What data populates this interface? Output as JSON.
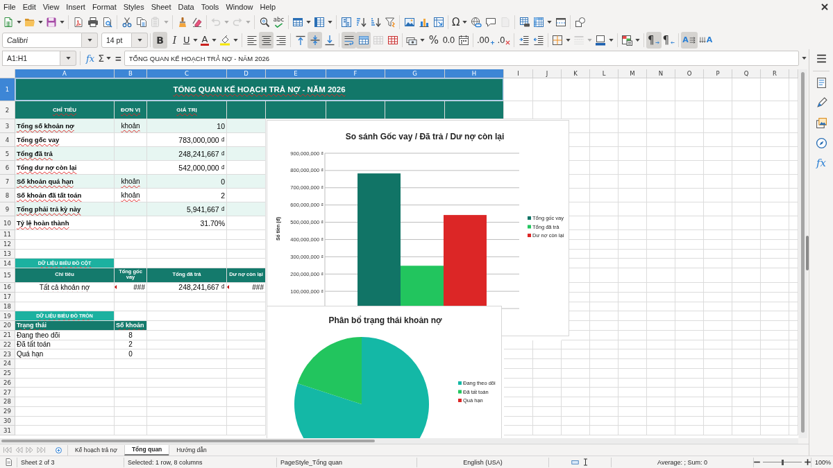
{
  "menu_bar": {
    "items": [
      "File",
      "Edit",
      "View",
      "Insert",
      "Format",
      "Styles",
      "Sheet",
      "Data",
      "Tools",
      "Window",
      "Help"
    ]
  },
  "standard_toolbar": {
    "groups": [
      [
        {
          "kind": "new",
          "disabled": false,
          "dropdown": true
        },
        {
          "kind": "open",
          "disabled": false,
          "dropdown": true
        },
        {
          "kind": "save",
          "disabled": false,
          "dropdown": true
        }
      ],
      [
        {
          "kind": "export_pdf",
          "disabled": false,
          "dropdown": false
        },
        {
          "kind": "print",
          "disabled": false,
          "dropdown": false
        },
        {
          "kind": "print_preview",
          "disabled": false,
          "dropdown": false
        }
      ],
      [
        {
          "kind": "cut",
          "disabled": false,
          "dropdown": false
        },
        {
          "kind": "copy",
          "disabled": false,
          "dropdown": false
        },
        {
          "kind": "paste",
          "disabled": true,
          "dropdown": true
        }
      ],
      [
        {
          "kind": "clone_format",
          "disabled": false,
          "dropdown": false
        },
        {
          "kind": "clear_format",
          "disabled": false,
          "dropdown": false
        }
      ],
      [
        {
          "kind": "undo",
          "disabled": true,
          "dropdown": true
        },
        {
          "kind": "redo",
          "disabled": true,
          "dropdown": true
        }
      ],
      [
        {
          "kind": "find_replace",
          "disabled": false,
          "dropdown": false
        },
        {
          "kind": "spelling",
          "label": "abc",
          "disabled": false,
          "dropdown": false
        }
      ],
      [
        {
          "kind": "row",
          "disabled": false,
          "dropdown": true
        },
        {
          "kind": "column",
          "disabled": false,
          "dropdown": true
        }
      ],
      [
        {
          "kind": "sort",
          "disabled": false,
          "dropdown": false
        },
        {
          "kind": "sort_ascending",
          "disabled": false,
          "dropdown": false
        },
        {
          "kind": "sort_descending",
          "disabled": false,
          "dropdown": false
        },
        {
          "kind": "autofilter",
          "disabled": false,
          "dropdown": false
        }
      ],
      [
        {
          "kind": "image",
          "disabled": false,
          "dropdown": false
        },
        {
          "kind": "chart",
          "disabled": false,
          "dropdown": false
        },
        {
          "kind": "pivot_table",
          "disabled": false,
          "dropdown": false
        }
      ],
      [
        {
          "kind": "special_character",
          "label": "Ω",
          "disabled": false,
          "dropdown": true
        },
        {
          "kind": "hyperlink",
          "disabled": false,
          "dropdown": false
        },
        {
          "kind": "comment",
          "disabled": false,
          "dropdown": false
        },
        {
          "kind": "header_footer",
          "disabled": true,
          "dropdown": false
        }
      ],
      [
        {
          "kind": "print_area",
          "disabled": false,
          "dropdown": false
        },
        {
          "kind": "freeze",
          "disabled": false,
          "dropdown": true
        },
        {
          "kind": "split_window",
          "disabled": false,
          "dropdown": false
        }
      ],
      [
        {
          "kind": "shapes",
          "disabled": false,
          "dropdown": false
        }
      ]
    ]
  },
  "format_toolbar": {
    "font_name": "Calibri",
    "font_size": "14 pt",
    "groups": [
      [
        {
          "kind": "bold",
          "label": "B",
          "pressed": true,
          "disabled": false,
          "dropdown": false
        },
        {
          "kind": "italic",
          "label": "I",
          "pressed": false,
          "disabled": false,
          "dropdown": false
        },
        {
          "kind": "underline",
          "label": "U",
          "pressed": false,
          "disabled": false,
          "dropdown": true
        },
        {
          "kind": "font_color",
          "label": "A",
          "pressed": false,
          "disabled": false,
          "dropdown": true
        },
        {
          "kind": "highlight",
          "pressed": false,
          "disabled": false,
          "dropdown": true
        }
      ],
      [
        {
          "kind": "align_left",
          "pressed": false,
          "disabled": false,
          "dropdown": false
        },
        {
          "kind": "align_center",
          "pressed": true,
          "disabled": false,
          "dropdown": false
        },
        {
          "kind": "align_right",
          "pressed": false,
          "disabled": false,
          "dropdown": false
        }
      ],
      [
        {
          "kind": "align_top",
          "pressed": false,
          "disabled": false,
          "dropdown": false
        },
        {
          "kind": "align_middle",
          "pressed": true,
          "disabled": false,
          "dropdown": false
        },
        {
          "kind": "align_bottom",
          "pressed": false,
          "disabled": false,
          "dropdown": false
        }
      ],
      [
        {
          "kind": "wrap",
          "pressed": true,
          "disabled": false,
          "dropdown": false
        },
        {
          "kind": "merge_center",
          "pressed": true,
          "disabled": false,
          "dropdown": false
        },
        {
          "kind": "merge",
          "pressed": false,
          "disabled": true,
          "dropdown": false
        },
        {
          "kind": "unmerge",
          "pressed": false,
          "disabled": false,
          "dropdown": false
        }
      ],
      [
        {
          "kind": "currency",
          "pressed": false,
          "disabled": false,
          "dropdown": true
        },
        {
          "kind": "percent",
          "label": "%",
          "pressed": false,
          "disabled": false,
          "dropdown": false
        },
        {
          "kind": "number",
          "label": "0.0",
          "pressed": false,
          "disabled": false,
          "dropdown": false
        },
        {
          "kind": "date",
          "pressed": false,
          "disabled": false,
          "dropdown": false
        }
      ],
      [
        {
          "kind": "add_decimal",
          "label": ".00",
          "pressed": false,
          "disabled": false,
          "dropdown": false
        },
        {
          "kind": "delete_decimal",
          "label": ".0",
          "pressed": false,
          "disabled": false,
          "dropdown": false
        }
      ],
      [
        {
          "kind": "indent",
          "pressed": false,
          "disabled": false,
          "dropdown": false
        },
        {
          "kind": "outdent",
          "pressed": false,
          "disabled": false,
          "dropdown": false
        }
      ],
      [
        {
          "kind": "borders",
          "pressed": false,
          "disabled": false,
          "dropdown": true
        },
        {
          "kind": "border_style",
          "pressed": false,
          "disabled": true,
          "dropdown": true
        },
        {
          "kind": "border_color",
          "pressed": false,
          "disabled": false,
          "dropdown": true
        }
      ],
      [
        {
          "kind": "conditional",
          "pressed": false,
          "disabled": false,
          "dropdown": true
        }
      ],
      [
        {
          "kind": "ltr",
          "label": "¶",
          "pressed": true,
          "disabled": false,
          "dropdown": false
        },
        {
          "kind": "rtl",
          "label": "¶",
          "pressed": false,
          "disabled": false,
          "dropdown": false
        }
      ],
      [
        {
          "kind": "text_direction",
          "label": "A",
          "pressed": true,
          "disabled": false,
          "dropdown": false
        },
        {
          "kind": "stacked",
          "label": "A",
          "pressed": false,
          "disabled": false,
          "dropdown": false
        }
      ]
    ]
  },
  "formula_bar": {
    "name_box": "A1:H1",
    "function_wizard": "fx",
    "sum": "Σ",
    "equals": "=",
    "content": "TỔNG QUAN KẾ HOẠCH TRẢ NỢ - NĂM 2026"
  },
  "sheet": {
    "columns": [
      {
        "label": "A",
        "selected": true
      },
      {
        "label": "B",
        "selected": true
      },
      {
        "label": "C",
        "selected": true
      },
      {
        "label": "D",
        "selected": true
      },
      {
        "label": "E",
        "selected": true
      },
      {
        "label": "F",
        "selected": true
      },
      {
        "label": "G",
        "selected": true
      },
      {
        "label": "H",
        "selected": true
      },
      {
        "label": "I",
        "selected": false
      },
      {
        "label": "J",
        "selected": false
      },
      {
        "label": "K",
        "selected": false
      },
      {
        "label": "L",
        "selected": false
      },
      {
        "label": "M",
        "selected": false
      },
      {
        "label": "N",
        "selected": false
      },
      {
        "label": "O",
        "selected": false
      },
      {
        "label": "P",
        "selected": false
      },
      {
        "label": "Q",
        "selected": false
      },
      {
        "label": "R",
        "selected": false
      }
    ],
    "rows": [
      {
        "label": "1",
        "selected": true,
        "kind": "plain",
        "cells": [
          {
            "kind": "title",
            "text": "TỔNG QUAN KẾ HOẠCH TRẢ NỢ - NĂM 2026"
          }
        ]
      },
      {
        "label": "2",
        "selected": false,
        "kind": "header",
        "cells": [
          {
            "kind": "header",
            "text": "CHỈ TIÊU"
          },
          {
            "kind": "header",
            "text": "ĐƠN VỊ"
          },
          {
            "kind": "header",
            "text": "GIÁ TRỊ"
          }
        ]
      },
      {
        "label": "3",
        "selected": false,
        "kind": "banded",
        "cells": [
          {
            "kind": "label",
            "text": "Tổng số khoản nợ"
          },
          {
            "kind": "unit",
            "text": "khoản"
          },
          {
            "kind": "number",
            "text": "10"
          }
        ]
      },
      {
        "label": "4",
        "selected": false,
        "kind": "plain",
        "cells": [
          {
            "kind": "label",
            "text": "Tổng gốc vay"
          },
          {
            "kind": "blank"
          },
          {
            "kind": "number",
            "text": "783,000,000 ₫"
          }
        ]
      },
      {
        "label": "5",
        "selected": false,
        "kind": "banded",
        "cells": [
          {
            "kind": "label",
            "text": "Tổng đã trả"
          },
          {
            "kind": "blank"
          },
          {
            "kind": "number",
            "text": "248,241,667 ₫"
          }
        ]
      },
      {
        "label": "6",
        "selected": false,
        "kind": "plain",
        "cells": [
          {
            "kind": "label",
            "text": "Tổng dư nợ còn lại"
          },
          {
            "kind": "blank"
          },
          {
            "kind": "number",
            "text": "542,000,000 ₫"
          }
        ]
      },
      {
        "label": "7",
        "selected": false,
        "kind": "banded",
        "cells": [
          {
            "kind": "label",
            "text": "Số khoản quá hạn"
          },
          {
            "kind": "unit",
            "text": "khoản"
          },
          {
            "kind": "number",
            "text": "0"
          }
        ]
      },
      {
        "label": "8",
        "selected": false,
        "kind": "plain",
        "cells": [
          {
            "kind": "label",
            "text": "Số khoản đã tất toán"
          },
          {
            "kind": "unit",
            "text": "khoản"
          },
          {
            "kind": "number",
            "text": "2"
          }
        ]
      },
      {
        "label": "9",
        "selected": false,
        "kind": "banded",
        "cells": [
          {
            "kind": "label",
            "text": "Tổng phải trả kỳ này"
          },
          {
            "kind": "blank"
          },
          {
            "kind": "number",
            "text": "5,941,667 ₫"
          }
        ]
      },
      {
        "label": "10",
        "selected": false,
        "kind": "plain",
        "cells": [
          {
            "kind": "label",
            "text": "Tỷ lệ hoàn thành"
          },
          {
            "kind": "blank"
          },
          {
            "kind": "number",
            "text": "31.70%"
          }
        ]
      },
      {
        "label": "11",
        "selected": false,
        "kind": "plain"
      },
      {
        "label": "12",
        "selected": false,
        "kind": "plain"
      },
      {
        "label": "13",
        "selected": false,
        "kind": "plain"
      },
      {
        "label": "14",
        "selected": false,
        "kind": "plain",
        "cells": [
          {
            "kind": "section",
            "text": "DỮ LIỆU BIỂU ĐỒ CỘT"
          }
        ]
      },
      {
        "label": "15",
        "selected": false,
        "kind": "plain",
        "cells": [
          {
            "kind": "column_header",
            "text": "Chỉ tiêu"
          },
          {
            "kind": "column_header",
            "text": "Tổng gốc vay"
          },
          {
            "kind": "column_header",
            "text": "Tổng đã trả"
          },
          {
            "kind": "column_header",
            "text": "Dư nợ còn lại"
          }
        ]
      },
      {
        "label": "16",
        "selected": false,
        "kind": "plain",
        "cells": [
          {
            "kind": "item",
            "text": "Tất cả khoản nợ"
          },
          {
            "kind": "overflow",
            "text": "###"
          },
          {
            "kind": "number",
            "text": "248,241,667 ₫"
          },
          {
            "kind": "overflow",
            "text": "###"
          }
        ]
      },
      {
        "label": "17",
        "selected": false,
        "kind": "plain"
      },
      {
        "label": "18",
        "selected": false,
        "kind": "plain"
      },
      {
        "label": "19",
        "selected": false,
        "kind": "plain",
        "cells": [
          {
            "kind": "section",
            "text": "DỮ LIỆU BIỂU ĐỒ TRÒN"
          }
        ]
      },
      {
        "label": "20",
        "selected": false,
        "kind": "plain",
        "cells": [
          {
            "kind": "subheader",
            "text": "Trạng thái"
          },
          {
            "kind": "subheader",
            "text": "Số khoản"
          }
        ]
      },
      {
        "label": "21",
        "selected": false,
        "kind": "plain",
        "cells": [
          {
            "kind": "text",
            "text": "Đang theo dõi"
          },
          {
            "kind": "count",
            "text": "8"
          }
        ]
      },
      {
        "label": "22",
        "selected": false,
        "kind": "plain",
        "cells": [
          {
            "kind": "text",
            "text": "Đã tất toán"
          },
          {
            "kind": "count",
            "text": "2"
          }
        ]
      },
      {
        "label": "23",
        "selected": false,
        "kind": "plain",
        "cells": [
          {
            "kind": "text",
            "text": "Quá hạn"
          },
          {
            "kind": "count",
            "text": "0"
          }
        ]
      },
      {
        "label": "24",
        "selected": false,
        "kind": "plain"
      },
      {
        "label": "25",
        "selected": false,
        "kind": "plain"
      },
      {
        "label": "26",
        "selected": false,
        "kind": "plain"
      },
      {
        "label": "27",
        "selected": false,
        "kind": "plain"
      },
      {
        "label": "28",
        "selected": false,
        "kind": "plain"
      },
      {
        "label": "29",
        "selected": false,
        "kind": "plain"
      },
      {
        "label": "30",
        "selected": false,
        "kind": "plain"
      },
      {
        "label": "31",
        "selected": false,
        "kind": "plain"
      }
    ]
  },
  "charts": [
    {
      "chart_data": {
        "type": "bar",
        "title": "So sánh Gốc vay / Đã trả / Dư nợ còn lại",
        "ylabel": "Số tiền (đ)",
        "legend": "right",
        "grid": true,
        "series": [
          {
            "name": "Tổng gốc vay",
            "color": "#117466",
            "values": [
              783000000
            ]
          },
          {
            "name": "Tổng đã trả",
            "color": "#22c55e",
            "values": [
              248000000
            ]
          },
          {
            "name": "Dư nợ còn lại",
            "color": "#dc2626",
            "values": [
              542000000
            ]
          }
        ],
        "ylim": [
          0,
          900000000
        ],
        "yticks": [
          {
            "value": 100000000,
            "label": "100,000,000 ₫"
          },
          {
            "value": 200000000,
            "label": "200,000,000 ₫"
          },
          {
            "value": 300000000,
            "label": "300,000,000 ₫"
          },
          {
            "value": 400000000,
            "label": "400,000,000 ₫"
          },
          {
            "value": 500000000,
            "label": "500,000,000 ₫"
          },
          {
            "value": 600000000,
            "label": "600,000,000 ₫"
          },
          {
            "value": 700000000,
            "label": "700,000,000 ₫"
          },
          {
            "value": 800000000,
            "label": "800,000,000 ₫"
          },
          {
            "value": 900000000,
            "label": "900,000,000 ₫"
          }
        ]
      }
    },
    {
      "chart_data": {
        "type": "pie",
        "title": "Phân bổ trạng thái khoản nợ",
        "legend": "right",
        "categories": [
          "Đang theo dõi",
          "Đã tất toán",
          "Quá hạn"
        ],
        "values": [
          80,
          20,
          0
        ],
        "colors": [
          "#14b8a6",
          "#22c55e",
          "#dc2626"
        ]
      }
    }
  ],
  "sheet_tabs": [
    {
      "label": "Kế hoạch trả nợ",
      "selected": false
    },
    {
      "label": "Tổng quan",
      "selected": true
    },
    {
      "label": "Hướng dẫn",
      "selected": false
    }
  ],
  "sidebar": {
    "buttons": [
      {
        "kind": "properties"
      },
      {
        "kind": "styles"
      },
      {
        "kind": "gallery"
      },
      {
        "kind": "navigator"
      },
      {
        "kind": "functions",
        "label": "fx"
      }
    ]
  },
  "status_bar": {
    "sheet": "Sheet 2 of 3",
    "selection": "Selected: 1 row, 8 columns",
    "page_style": "PageStyle_Tổng quan",
    "language": "English (USA)",
    "summary": "Average: ; Sum: 0",
    "zoom": {
      "level": 0.5,
      "reading": "100%"
    }
  }
}
